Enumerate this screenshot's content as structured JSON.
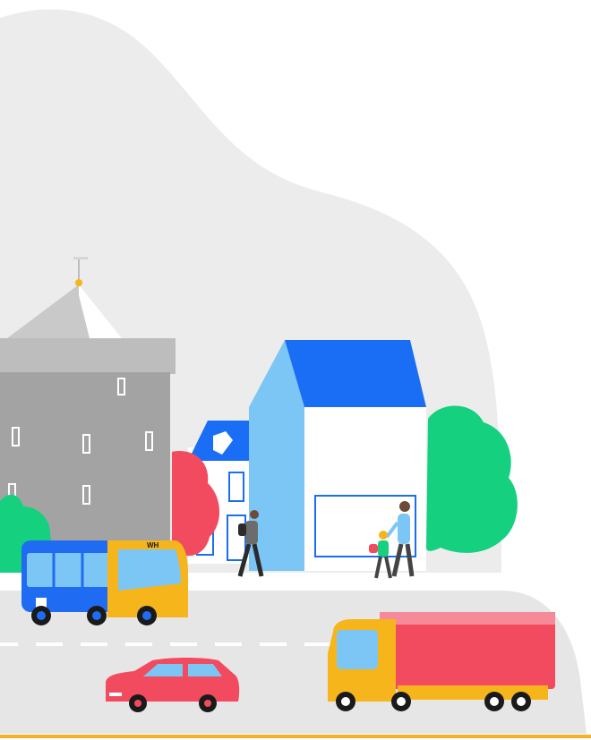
{
  "scene": {
    "colors": {
      "hill": "#ececec",
      "road": "#e6e6e6",
      "tower": "#a3a3a3",
      "tower_roof": "#c9c9c9",
      "house_roof": "#1a6ef5",
      "house_side": "#7cc6f5",
      "house_front": "#ffffff",
      "tree_green": "#14d07f",
      "tree_red": "#f24b5f",
      "bus_body": "#1f6cf2",
      "bus_front": "#f7b51c",
      "truck_cab": "#f7b51c",
      "truck_cargo": "#f24b5f",
      "car": "#f24b5f",
      "ground_line": "#f2b32a"
    },
    "bus_logo_text": "WH"
  }
}
